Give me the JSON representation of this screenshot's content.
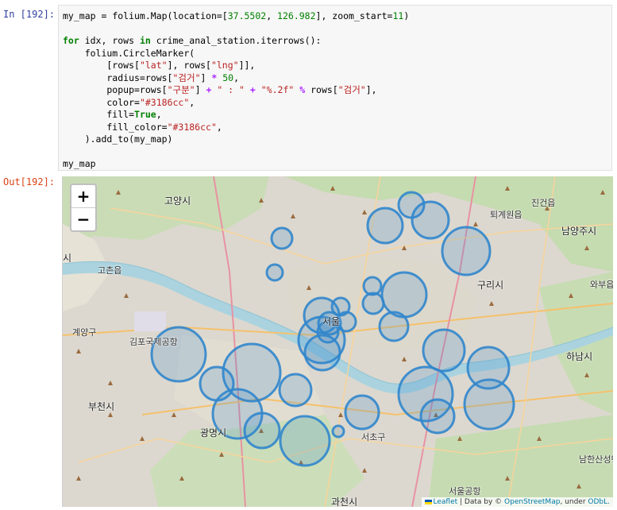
{
  "cells": {
    "input_prompt": "In [192]:",
    "output_prompt": "Out[192]:"
  },
  "code": {
    "line1_var": "my_map",
    "line1_eq": " = folium.Map(location=[",
    "line1_lat": "37.5502",
    "line1_comma": ", ",
    "line1_lng": "126.982",
    "line1_mid": "], zoom_start=",
    "line1_zoom": "11",
    "line1_end": ")",
    "line3_for": "for",
    "line3_mid": " idx, rows ",
    "line3_in": "in",
    "line3_end": " crime_anal_station.iterrows():",
    "line4": "    folium.CircleMarker(",
    "line5_a": "        [rows[",
    "line5_lat": "\"lat\"",
    "line5_b": "], rows[",
    "line5_lng": "\"lng\"",
    "line5_c": "]],",
    "line6_a": "        radius=rows[",
    "line6_key": "\"검거\"",
    "line6_b": "] ",
    "line6_op": "*",
    "line6_c": " ",
    "line6_num": "50",
    "line6_d": ",",
    "line7_a": "        popup=rows[",
    "line7_key": "\"구분\"",
    "line7_b": "] ",
    "line7_op1": "+",
    "line7_c": " ",
    "line7_sep": "\" : \"",
    "line7_d": " ",
    "line7_op2": "+",
    "line7_e": " ",
    "line7_fmt": "\"%.2f\"",
    "line7_f": " ",
    "line7_op3": "%",
    "line7_g": " rows[",
    "line7_key2": "\"검거\"",
    "line7_h": "],",
    "line8_a": "        color=",
    "line8_val": "\"#3186cc\"",
    "line8_b": ",",
    "line9_a": "        fill=",
    "line9_val": "True",
    "line9_b": ",",
    "line10_a": "        fill_color=",
    "line10_val": "\"#3186cc\"",
    "line10_b": ",",
    "line11": "    ).add_to(my_map)",
    "line13": "my_map"
  },
  "map": {
    "zoom_in": "+",
    "zoom_out": "−",
    "marker_color": "#3186cc",
    "places": [
      {
        "name": "고양시",
        "big": true
      },
      {
        "name": "진건읍",
        "big": false
      },
      {
        "name": "퇴계원읍",
        "big": false
      },
      {
        "name": "남양주시",
        "big": true
      },
      {
        "name": "고촌읍",
        "big": false
      },
      {
        "name": "구리시",
        "big": true
      },
      {
        "name": "와부읍",
        "big": false
      },
      {
        "name": "계양구",
        "big": false
      },
      {
        "name": "김포국제공항",
        "big": false
      },
      {
        "name": "서울",
        "big": true
      },
      {
        "name": "하남시",
        "big": true
      },
      {
        "name": "부천시",
        "big": true
      },
      {
        "name": "광명시",
        "big": true
      },
      {
        "name": "서초구",
        "big": false
      },
      {
        "name": "남한산성면",
        "big": false
      },
      {
        "name": "과천시",
        "big": true
      },
      {
        "name": "시",
        "big": true
      },
      {
        "name": "서울공항",
        "big": false
      }
    ],
    "attribution": {
      "leaflet": "Leaflet",
      "data_by": " | Data by © ",
      "osm": "OpenStreetMap",
      "under": ", under ",
      "odbl": "ODbL."
    }
  }
}
